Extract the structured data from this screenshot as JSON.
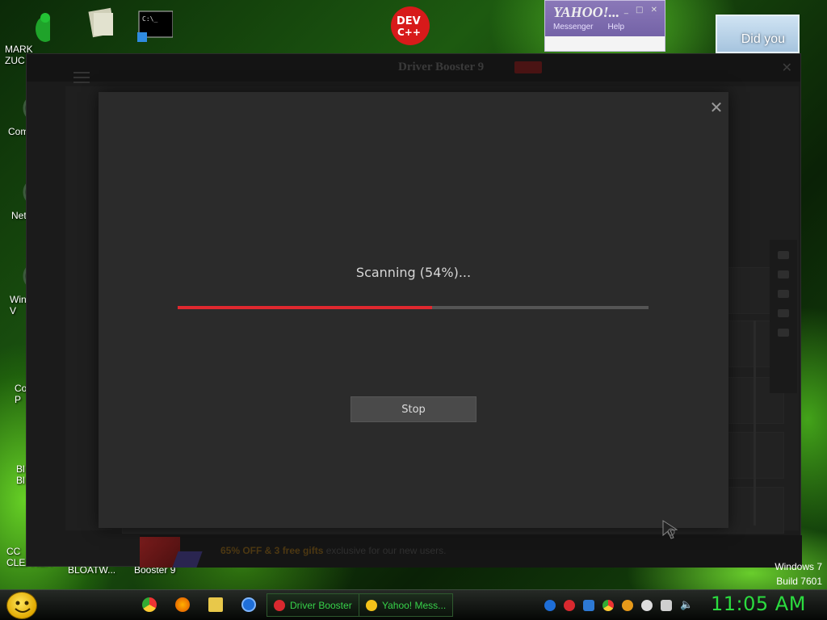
{
  "desktop": {
    "icons_left": [
      {
        "label": "MARK\nZUC",
        "name": "desktop-icon-mark-zuc"
      },
      {
        "label": "Com",
        "name": "desktop-icon-computer"
      },
      {
        "label": "Net",
        "name": "desktop-icon-network"
      },
      {
        "label": "Win\nV",
        "name": "desktop-icon-windows-v"
      },
      {
        "label": "Co\nP",
        "name": "desktop-icon-control-panel"
      },
      {
        "label": "Bl\nBl",
        "name": "desktop-icon-bl"
      },
      {
        "label": "CC\nCLEANER",
        "name": "desktop-icon-ccleaner"
      }
    ],
    "bottom_labels": [
      "BLOATW...",
      "Booster 9"
    ],
    "yahoo_window": {
      "title": "YAHOO!...",
      "menu": [
        "Messenger",
        "Help"
      ]
    },
    "popup_text": "Did you",
    "watermark_line1": "Windows 7",
    "watermark_line2": "Build 7601"
  },
  "app": {
    "title": "Driver Booster 9",
    "promo_highlight": "65% OFF & 3 free gifts",
    "promo_text": " exclusive for our new users."
  },
  "dialog": {
    "status_text": "Scanning (54%)...",
    "progress": 0.54,
    "stop_label": "Stop",
    "accent": "#e0282f"
  },
  "taskbar": {
    "tasks": [
      {
        "label": "Driver Booster",
        "name": "taskbar-driver-booster",
        "icon_color": "#d9292f"
      },
      {
        "label": "Yahoo! Mess...",
        "name": "taskbar-yahoo-messenger",
        "icon_color": "#f3c21a"
      }
    ],
    "clock": "11:05 AM"
  }
}
